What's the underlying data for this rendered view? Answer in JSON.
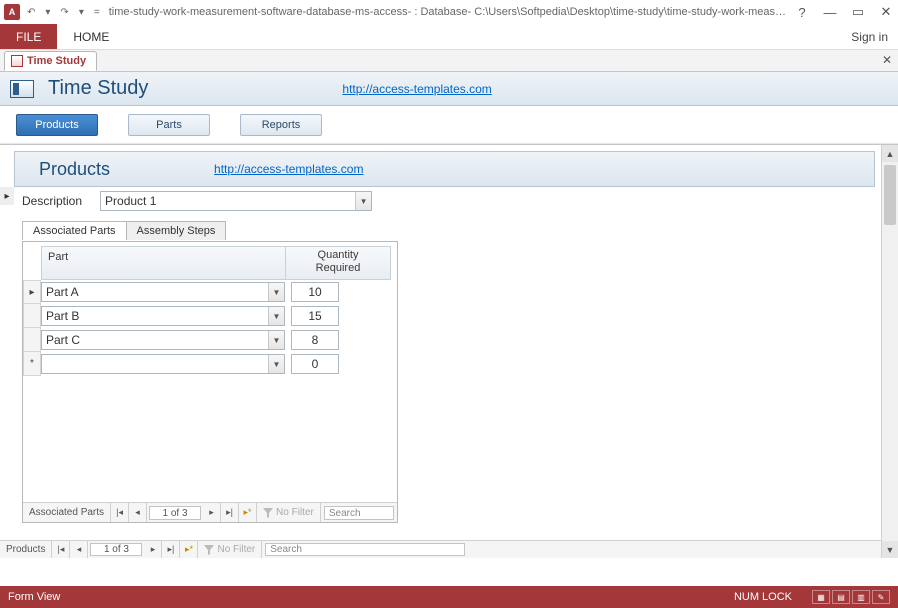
{
  "titlebar": {
    "path": "time-study-work-measurement-software-database-ms-access- : Database- C:\\Users\\Softpedia\\Desktop\\time-study\\time-study-work-measurem..."
  },
  "ribbon": {
    "file": "FILE",
    "home": "HOME",
    "signin": "Sign in"
  },
  "docTab": {
    "label": "Time Study"
  },
  "header": {
    "title": "Time Study",
    "link": "http://access-templates.com"
  },
  "nav": {
    "products": "Products",
    "parts": "Parts",
    "reports": "Reports"
  },
  "subheader": {
    "title": "Products",
    "link": "http://access-templates.com"
  },
  "form": {
    "descLabel": "Description",
    "descValue": "Product 1"
  },
  "innerTabs": {
    "assoc": "Associated Parts",
    "assembly": "Assembly Steps"
  },
  "subform": {
    "col1": "Part",
    "col2a": "Quantity",
    "col2b": "Required",
    "rows": [
      {
        "part": "Part A",
        "qty": "10"
      },
      {
        "part": "Part B",
        "qty": "15"
      },
      {
        "part": "Part C",
        "qty": "8"
      },
      {
        "part": "",
        "qty": "0"
      }
    ],
    "nav": {
      "label": "Associated Parts",
      "counter": "1 of 3",
      "noFilter": "No Filter",
      "search": "Search"
    }
  },
  "formNav": {
    "label": "Products",
    "counter": "1 of 3",
    "noFilter": "No Filter",
    "search": "Search"
  },
  "statusbar": {
    "left": "Form View",
    "numlock": "NUM LOCK"
  }
}
